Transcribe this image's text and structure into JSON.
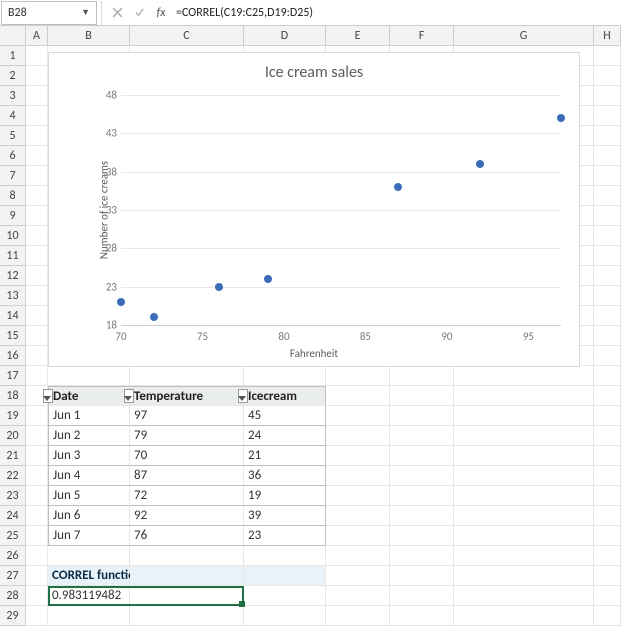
{
  "formula_bar": {
    "active_cell": "B28",
    "formula": "=CORREL(C19:C25,D19:D25)"
  },
  "columns": [
    "A",
    "B",
    "C",
    "D",
    "E",
    "F",
    "G",
    "H"
  ],
  "rows": [
    1,
    2,
    3,
    4,
    5,
    6,
    7,
    8,
    9,
    10,
    11,
    12,
    13,
    14,
    15,
    16,
    17,
    18,
    19,
    20,
    21,
    22,
    23,
    24,
    25,
    26,
    27,
    28,
    29
  ],
  "table": {
    "headers": {
      "date": "Date",
      "temperature": "Temperature",
      "icecream": "Icecream"
    },
    "rows": [
      {
        "date": "Jun 1",
        "temperature": "97",
        "icecream": "45"
      },
      {
        "date": "Jun 2",
        "temperature": "79",
        "icecream": "24"
      },
      {
        "date": "Jun 3",
        "temperature": "70",
        "icecream": "21"
      },
      {
        "date": "Jun 4",
        "temperature": "87",
        "icecream": "36"
      },
      {
        "date": "Jun 5",
        "temperature": "72",
        "icecream": "19"
      },
      {
        "date": "Jun 6",
        "temperature": "92",
        "icecream": "39"
      },
      {
        "date": "Jun 7",
        "temperature": "76",
        "icecream": "23"
      }
    ]
  },
  "section_label": "CORREL function",
  "result_value": "0.983119482",
  "chart_data": {
    "type": "scatter",
    "title": "Ice cream sales",
    "xlabel": "Fahrenheit",
    "ylabel": "Number of ice creams",
    "xlim": [
      70,
      97
    ],
    "ylim": [
      18,
      48
    ],
    "xticks": [
      70,
      75,
      80,
      85,
      90,
      95
    ],
    "yticks": [
      18,
      23,
      28,
      33,
      38,
      43,
      48
    ],
    "series": [
      {
        "name": "Icecream",
        "x": [
          97,
          79,
          70,
          87,
          72,
          92,
          76
        ],
        "y": [
          45,
          24,
          21,
          36,
          19,
          39,
          23
        ]
      }
    ]
  }
}
